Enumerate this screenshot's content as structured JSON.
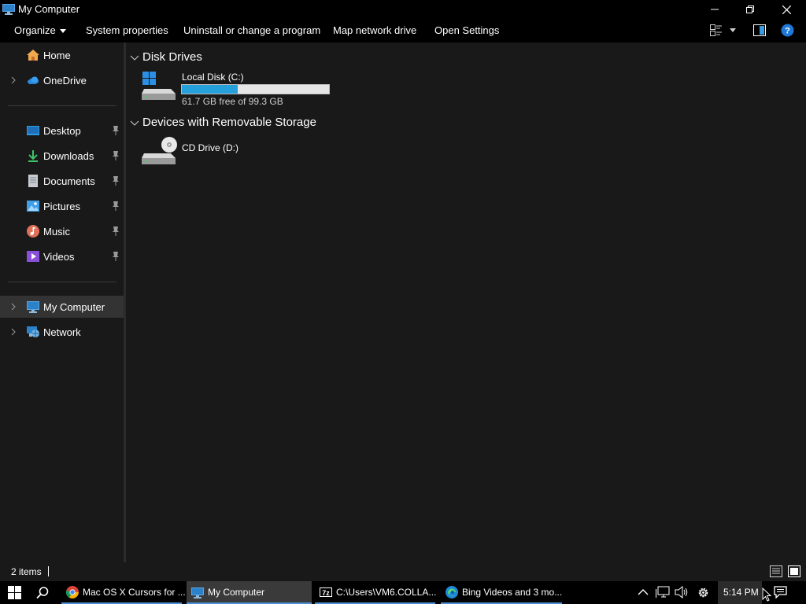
{
  "window": {
    "title": "My Computer",
    "icon": "computer-icon",
    "controls": {
      "minimize": "minimize-icon",
      "restore": "restore-icon",
      "close": "close-icon"
    }
  },
  "commandbar": {
    "organize": "Organize",
    "system_properties": "System properties",
    "uninstall": "Uninstall or change a program",
    "map_drive": "Map network drive",
    "open_settings": "Open Settings"
  },
  "sidebar": {
    "home": "Home",
    "onedrive": "OneDrive",
    "quick_access": [
      {
        "label": "Desktop",
        "icon": "desktop-icon"
      },
      {
        "label": "Downloads",
        "icon": "download-icon"
      },
      {
        "label": "Documents",
        "icon": "document-icon"
      },
      {
        "label": "Pictures",
        "icon": "pictures-icon"
      },
      {
        "label": "Music",
        "icon": "music-icon"
      },
      {
        "label": "Videos",
        "icon": "videos-icon"
      }
    ],
    "my_computer": "My Computer",
    "network": "Network"
  },
  "content": {
    "groups": [
      {
        "header": "Disk Drives",
        "items": [
          {
            "name": "Local Disk (C:)",
            "free_text": "61.7 GB free of 99.3 GB",
            "used_fraction": 0.379
          }
        ]
      },
      {
        "header": "Devices with Removable Storage",
        "items": [
          {
            "name": "CD Drive (D:)"
          }
        ]
      }
    ]
  },
  "status": {
    "item_count": "2 items"
  },
  "taskbar": {
    "apps": [
      {
        "label": "Mac OS X Cursors for ...",
        "icon": "chrome-icon"
      },
      {
        "label": "My Computer",
        "icon": "computer-icon"
      },
      {
        "label": "C:\\Users\\VM6.COLLA...",
        "icon": "7zip-icon"
      },
      {
        "label": "Bing Videos and 3 mo...",
        "icon": "edge-icon"
      }
    ],
    "clock": "5:14 PM"
  },
  "colors": {
    "accent": "#26a0da",
    "background": "#191919",
    "chrome": "#000000"
  }
}
